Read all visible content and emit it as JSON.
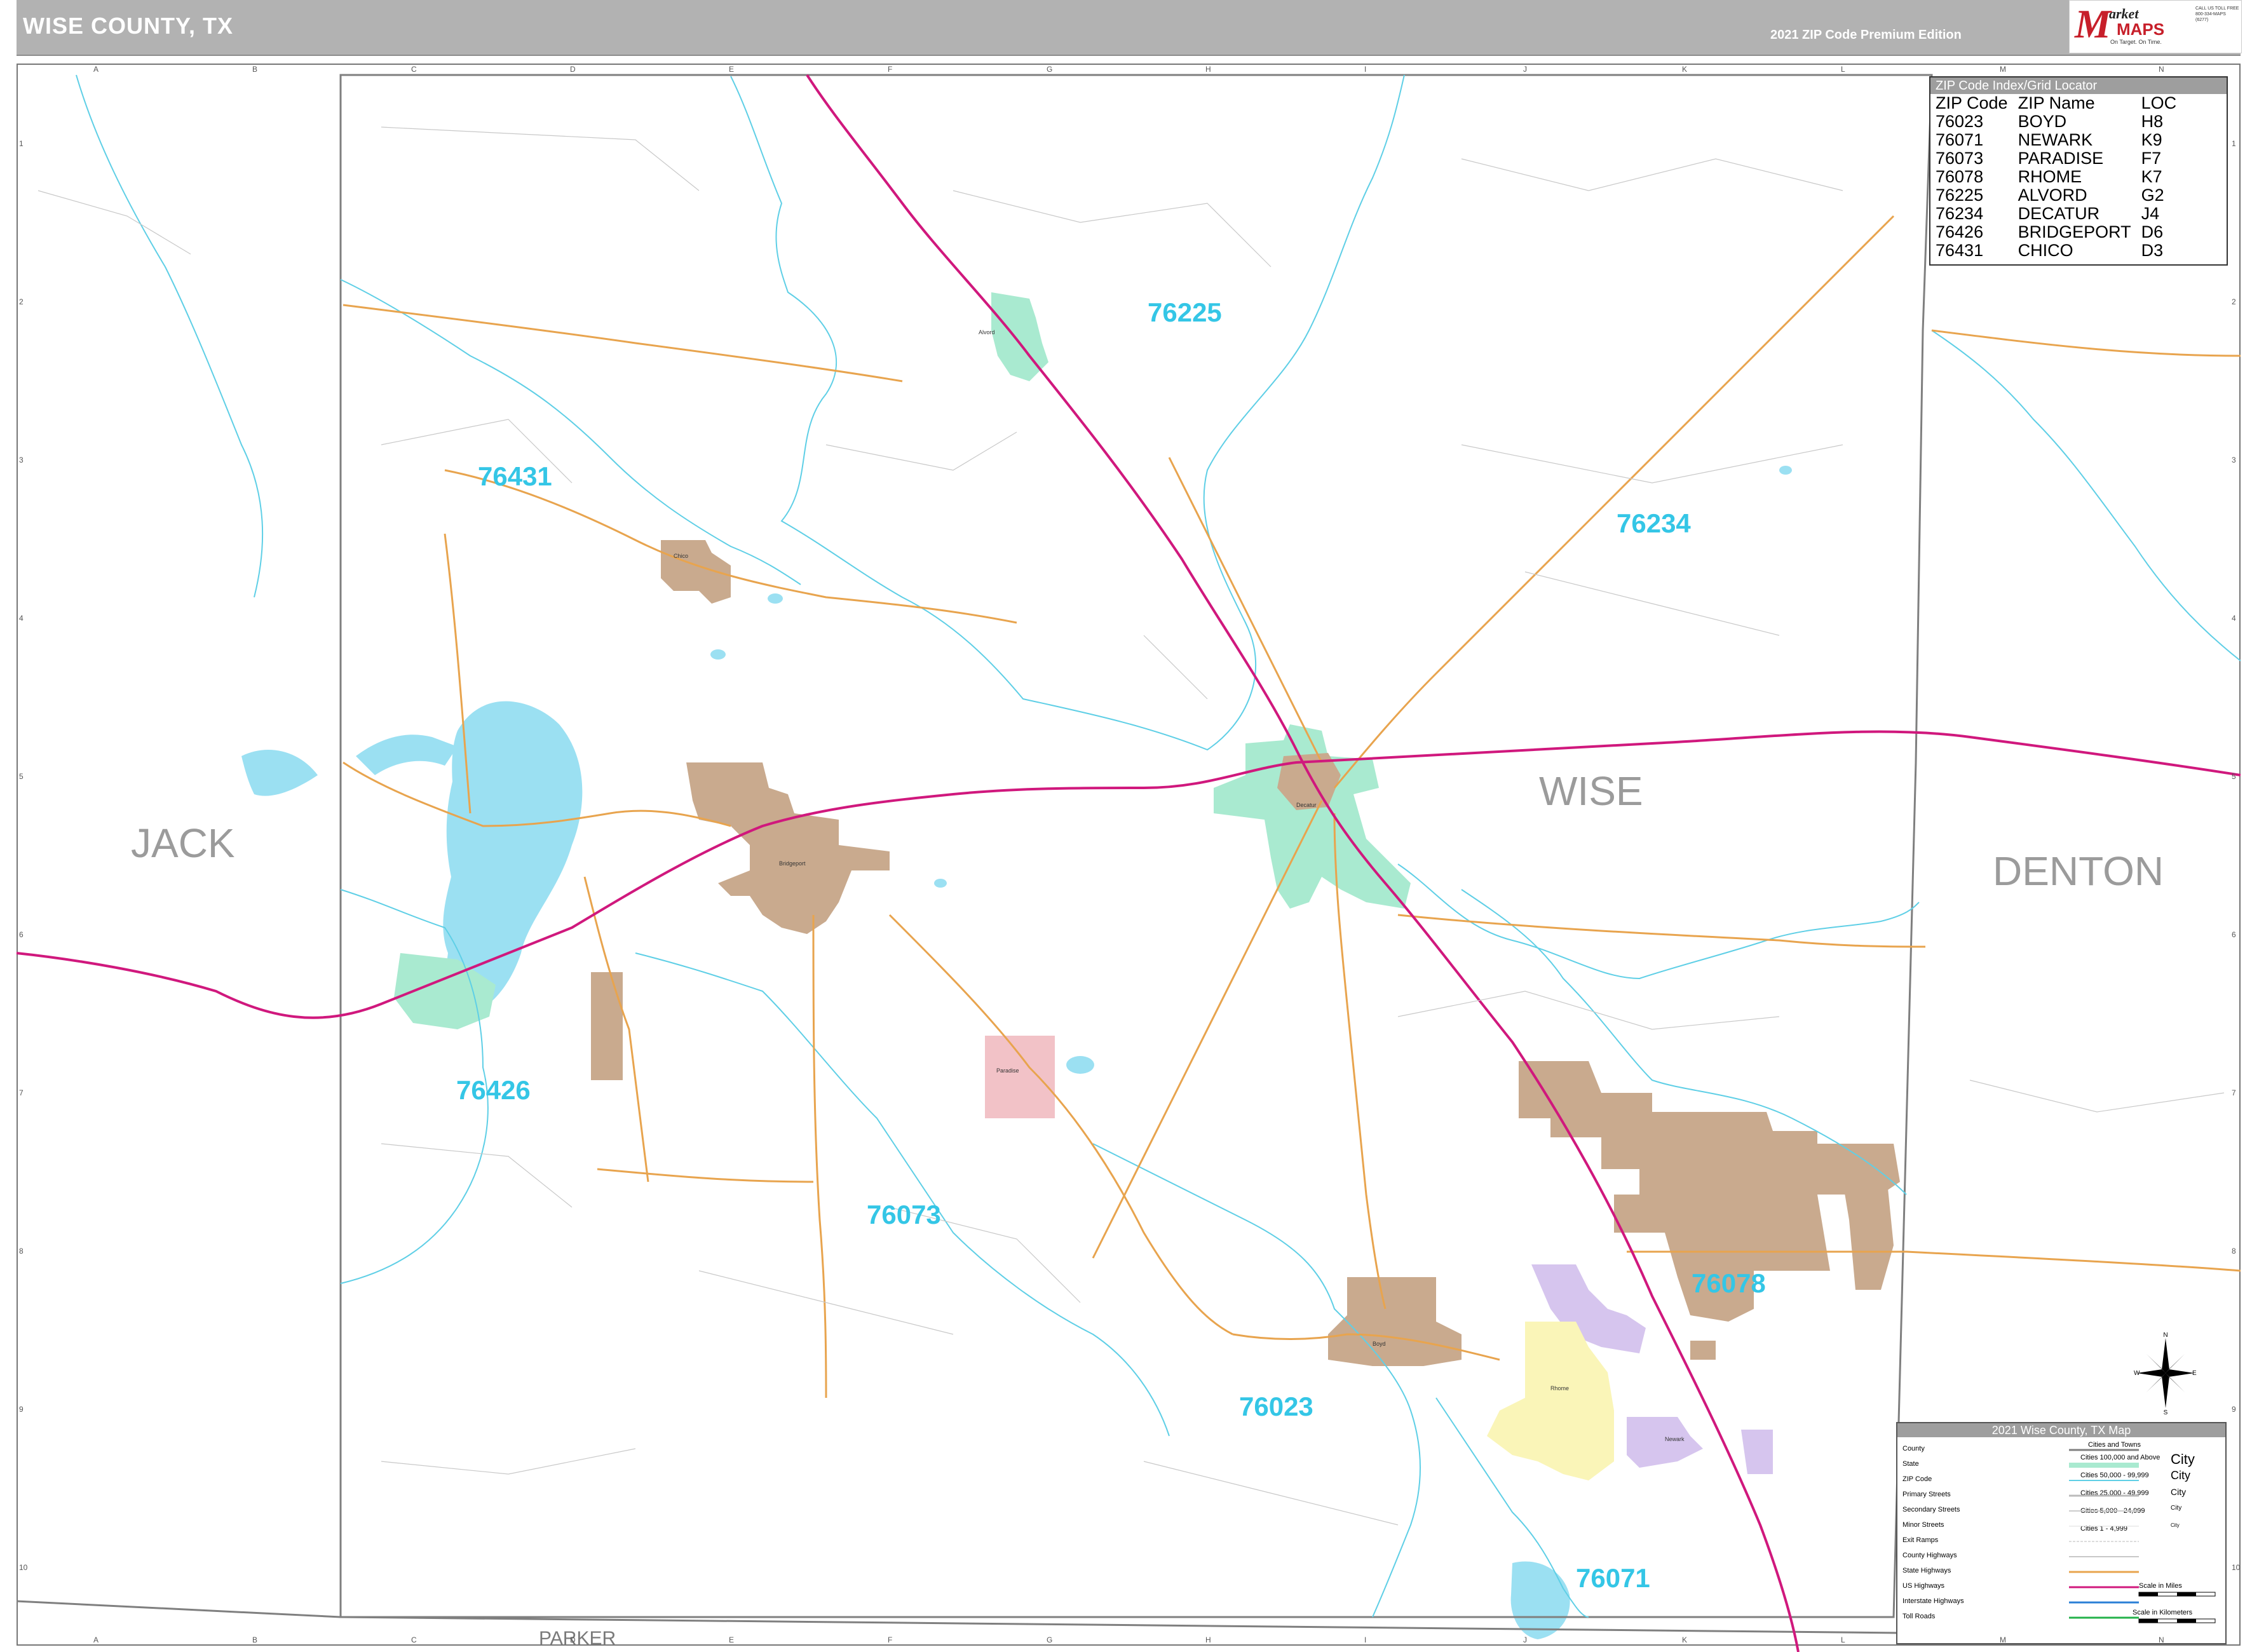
{
  "header": {
    "title": "WISE COUNTY, TX",
    "edition": "2021 ZIP Code Premium Edition"
  },
  "logo": {
    "m": "M",
    "market": "arket",
    "maps": "MAPS",
    "tagline": "On Target.  On Time.",
    "contact": "CALL US TOLL FREE 800-334-MAPS (6277)"
  },
  "zip_index": {
    "title": "ZIP Code Index/Grid Locator",
    "headers": [
      "ZIP Code",
      "ZIP Name",
      "LOC"
    ],
    "rows": [
      [
        "76023",
        "BOYD",
        "H8"
      ],
      [
        "76071",
        "NEWARK",
        "K9"
      ],
      [
        "76073",
        "PARADISE",
        "F7"
      ],
      [
        "76078",
        "RHOME",
        "K7"
      ],
      [
        "76225",
        "ALVORD",
        "G2"
      ],
      [
        "76234",
        "DECATUR",
        "J4"
      ],
      [
        "76426",
        "BRIDGEPORT",
        "D6"
      ],
      [
        "76431",
        "CHICO",
        "D3"
      ]
    ]
  },
  "zip_labels": [
    "76225",
    "76431",
    "76234",
    "76426",
    "76073",
    "76078",
    "76023",
    "76071"
  ],
  "county_labels": {
    "jack": "JACK",
    "wise": "WISE",
    "denton": "DENTON",
    "parker": "PARKER"
  },
  "grid_columns": [
    "A",
    "B",
    "C",
    "D",
    "E",
    "F",
    "G",
    "H",
    "I",
    "J",
    "K",
    "L",
    "M",
    "N"
  ],
  "grid_rows": [
    "1",
    "2",
    "3",
    "4",
    "5",
    "6",
    "7",
    "8",
    "9",
    "10"
  ],
  "legend": {
    "title": "2021 Wise County, TX Map",
    "items": [
      "County",
      "State",
      "ZIP Code",
      "Primary Streets",
      "Secondary Streets",
      "Minor Streets",
      "Exit Ramps",
      "County Highways",
      "State Highways",
      "US Highways",
      "Interstate Highways",
      "Toll Roads"
    ],
    "cities_header": "Cities and Towns",
    "city_classes": [
      "Cities 100,000 and Above",
      "Cities 50,000 - 99,999",
      "Cities 25,000 - 49,999",
      "Cities 5,000 - 24,999",
      "Cities 1 - 4,999"
    ],
    "city_samples": [
      "City",
      "City",
      "City",
      "City",
      "City"
    ],
    "scale_miles": "Scale in Miles",
    "scale_km": "Scale in Kilometers"
  },
  "compass": {
    "n": "N",
    "s": "S",
    "e": "E",
    "w": "W"
  },
  "colors": {
    "water": "#9be0f2",
    "zip_boundary": "#5fcfe6",
    "us_highway": "#d0187d",
    "state_highway": "#e8a44e",
    "city_tan": "#c9aa8e",
    "city_green": "#a9ead0",
    "city_pink": "#f2c2c7",
    "city_purple": "#d6c5ee",
    "city_yellow": "#faf5b8",
    "county_line": "#7f7f7f"
  },
  "towns": [
    "Alvord",
    "Chico",
    "Bridgeport",
    "Decatur",
    "Paradise",
    "Boyd",
    "Rhome",
    "Newark"
  ]
}
